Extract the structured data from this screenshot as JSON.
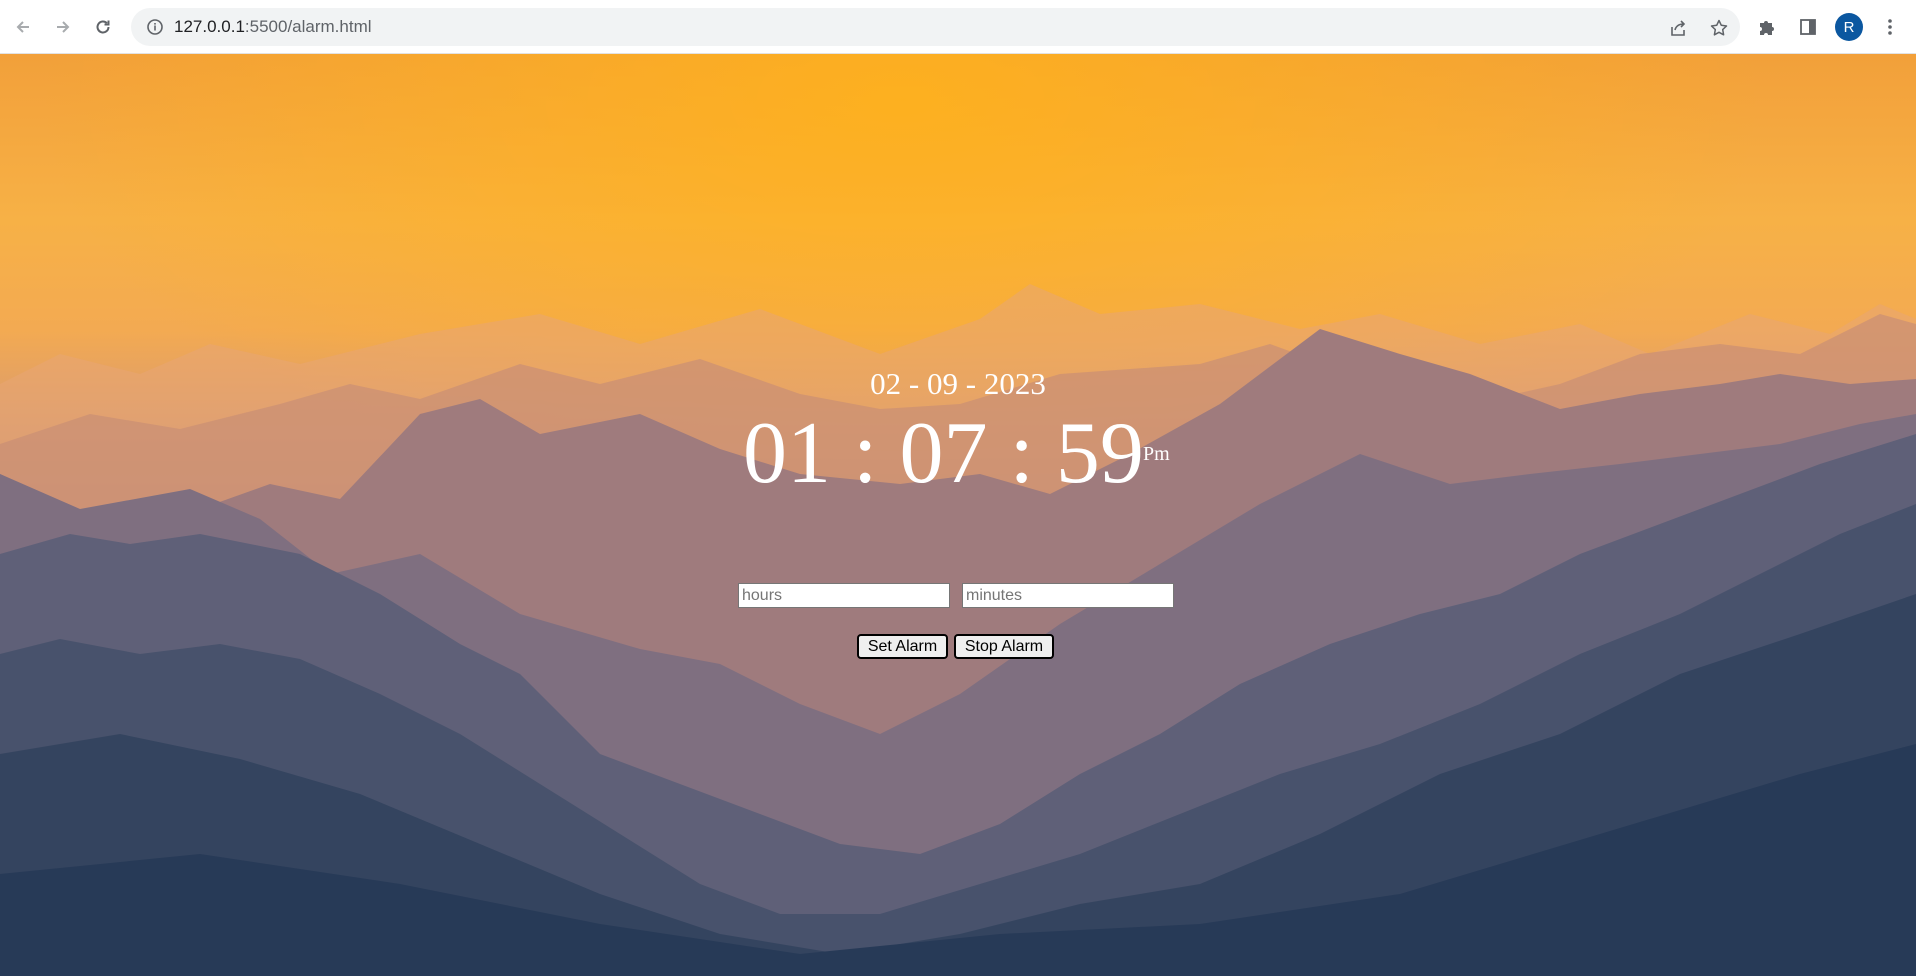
{
  "browser": {
    "url_host": "127.0.0.1",
    "url_path": ":5500/alarm.html",
    "avatar_letter": "R"
  },
  "clock": {
    "date": "02 - 09 - 2023",
    "time": "01 : 07 : 59",
    "ampm": "Pm"
  },
  "alarm": {
    "hours_placeholder": "hours",
    "minutes_placeholder": "minutes",
    "set_label": "Set Alarm",
    "stop_label": "Stop Alarm"
  },
  "colors": {
    "avatar": "#0b57a0",
    "sky_top": "#f2a03a",
    "mountains_far": "#2f4364"
  }
}
